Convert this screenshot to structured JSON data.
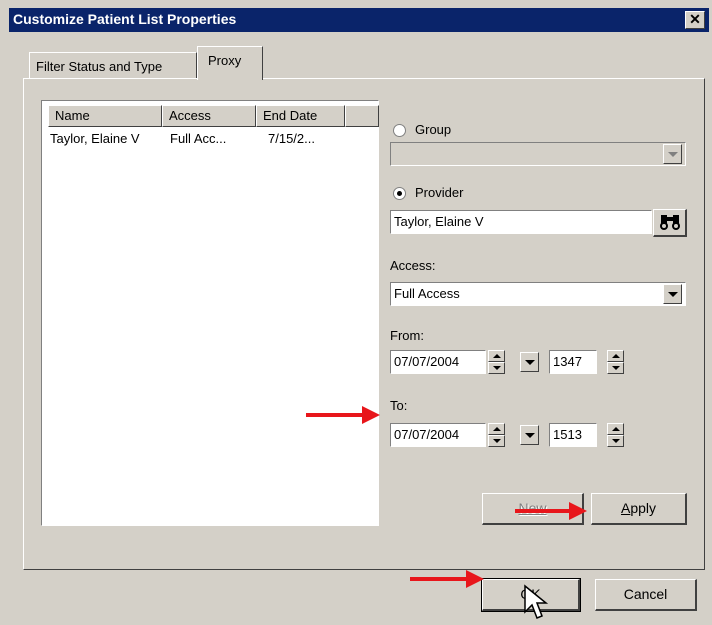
{
  "window": {
    "title": "Customize Patient List Properties",
    "close_glyph": "✕"
  },
  "tabs": [
    {
      "label": "Filter Status and Type"
    },
    {
      "label": "Proxy"
    }
  ],
  "proxy_list": {
    "columns": [
      "Name",
      "Access",
      "End Date"
    ],
    "rows": [
      {
        "name": "Taylor, Elaine V",
        "access": "Full Acc...",
        "end_date": "7/15/2..."
      }
    ]
  },
  "group": {
    "label": "Group",
    "value": ""
  },
  "provider": {
    "label": "Provider",
    "value": "Taylor, Elaine V",
    "search_icon": "binoculars-icon"
  },
  "access": {
    "label": "Access:",
    "value": "Full Access"
  },
  "from": {
    "label": "From:",
    "date": "07/07/2004",
    "time": "1347"
  },
  "to": {
    "label": "To:",
    "date": "07/07/2004",
    "time": "1513"
  },
  "buttons": {
    "new": "New",
    "apply_rest": "pply",
    "apply_accel": "A",
    "ok": "OK",
    "cancel": "Cancel"
  },
  "annotation_color": "#e8161b"
}
